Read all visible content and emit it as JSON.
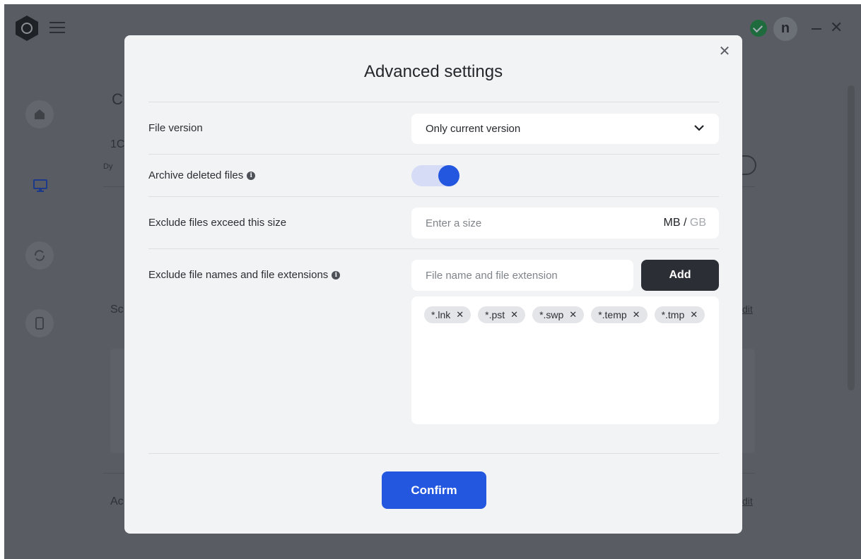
{
  "background": {
    "avatar_letter": "n",
    "heading_fragment": "C",
    "number_fragment": "1C",
    "small_fragment": "Dy",
    "section2_fragment": "Sc",
    "section3_fragment": "Ac",
    "edit_link_1": "dit",
    "edit_link_2": "dit"
  },
  "modal": {
    "title": "Advanced settings",
    "close_label": "✕",
    "file_version": {
      "label": "File version",
      "selected": "Only current version"
    },
    "archive_deleted": {
      "label": "Archive deleted files",
      "enabled": true
    },
    "exclude_size": {
      "label": "Exclude files exceed this size",
      "placeholder": "Enter a size",
      "unit_mb": "MB",
      "unit_sep": " / ",
      "unit_gb": "GB"
    },
    "exclude_names": {
      "label": "Exclude file names and file extensions",
      "placeholder": "File name and file extension",
      "add_label": "Add",
      "tags": [
        "*.lnk",
        "*.pst",
        "*.swp",
        "*.temp",
        "*.tmp"
      ]
    },
    "confirm_label": "Confirm"
  },
  "colors": {
    "accent": "#2457df",
    "dark_button": "#2b2f35",
    "overlay": "#595d63"
  }
}
